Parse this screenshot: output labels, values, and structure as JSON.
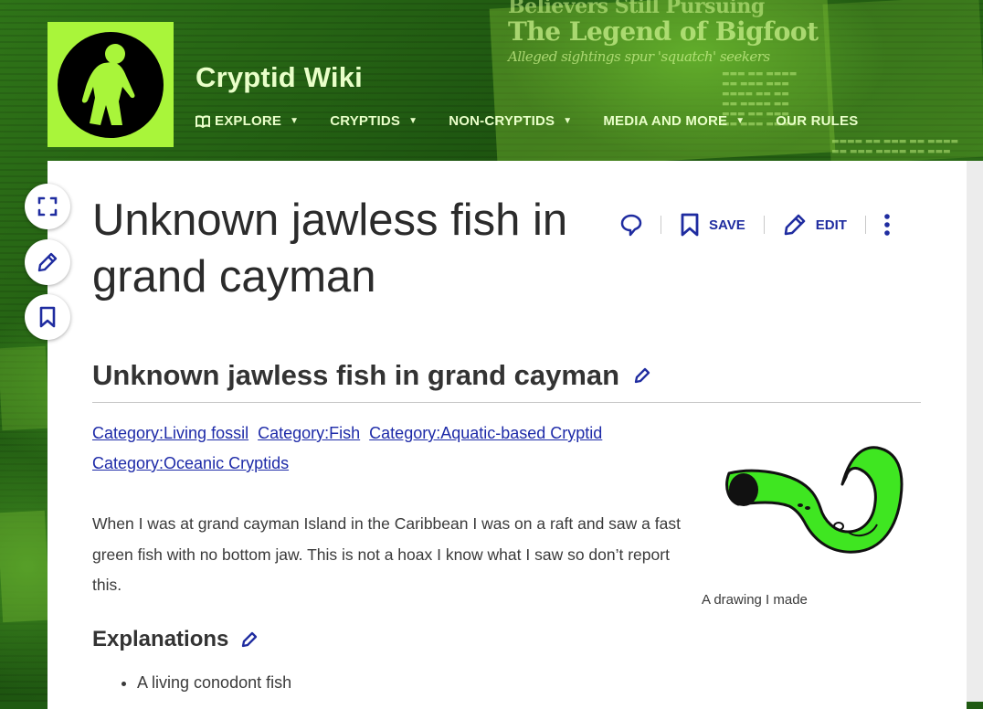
{
  "site": {
    "name": "Cryptid Wiki",
    "logo_icon": "bigfoot-icon",
    "accent_color": "#a9f53a",
    "link_color": "#1d2aa8"
  },
  "background": {
    "headline_top": "Believers Still Pursuing",
    "headline_main": "The Legend of Bigfoot",
    "headline_sub": "Alleged sightings spur 'squatch' seekers"
  },
  "nav": {
    "items": [
      {
        "label": "EXPLORE",
        "icon": "book-icon",
        "has_dropdown": true
      },
      {
        "label": "CRYPTIDS",
        "has_dropdown": true
      },
      {
        "label": "NON-CRYPTIDS",
        "has_dropdown": true
      },
      {
        "label": "MEDIA AND MORE",
        "has_dropdown": true
      },
      {
        "label": "OUR RULES",
        "has_dropdown": false
      }
    ]
  },
  "tools": [
    "expand-icon",
    "pencil-icon",
    "bookmark-icon"
  ],
  "page": {
    "title": "Unknown jawless fish in grand cayman",
    "actions": {
      "save_label": "SAVE",
      "edit_label": "EDIT"
    },
    "heading": "Unknown jawless fish in grand cayman",
    "categories": [
      "Category:Living fossil",
      "Category:Fish",
      "Category:Aquatic-based Cryptid",
      "Category:Oceanic Cryptids"
    ],
    "paragraph": "When I was at grand cayman Island in the Caribbean I was on a raft and saw a fast green fish with no bottom jaw. This is not a hoax I know what I saw so don’t report this.",
    "figure_caption": "A drawing I made",
    "explanations_heading": "Explanations",
    "explanations": [
      "A living conodont fish"
    ]
  }
}
